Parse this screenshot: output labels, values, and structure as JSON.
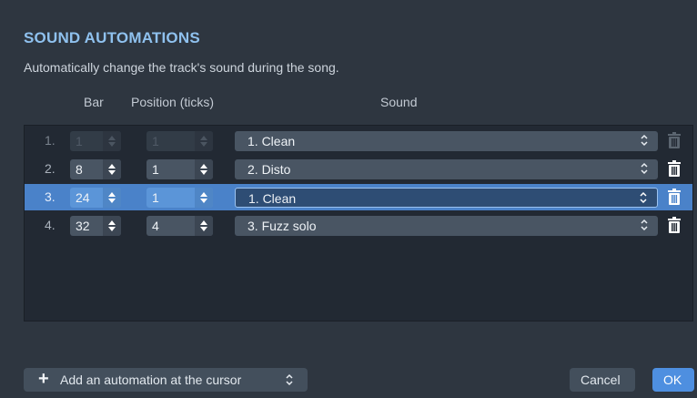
{
  "dialog": {
    "title": "SOUND AUTOMATIONS",
    "subtitle": "Automatically change the track's sound during the song."
  },
  "columns": {
    "bar": "Bar",
    "position": "Position (ticks)",
    "sound": "Sound"
  },
  "rows": [
    {
      "num": "1.",
      "bar": "1",
      "position": "1",
      "sound": "1. Clean",
      "state": "disabled"
    },
    {
      "num": "2.",
      "bar": "8",
      "position": "1",
      "sound": "2. Disto",
      "state": "normal"
    },
    {
      "num": "3.",
      "bar": "24",
      "position": "1",
      "sound": "1. Clean",
      "state": "selected"
    },
    {
      "num": "4.",
      "bar": "32",
      "position": "4",
      "sound": "3. Fuzz solo",
      "state": "normal"
    }
  ],
  "footer": {
    "add_label": "Add an automation at the cursor",
    "cancel_label": "Cancel",
    "ok_label": "OK"
  },
  "icons": {
    "add": "plus-icon",
    "select": "chevron-updown-icon",
    "stepper": "stepper-arrows-icon",
    "delete": "trash-icon"
  },
  "colors": {
    "background": "#2e3640",
    "title": "#8fc1ee",
    "selection": "#4a82c9",
    "ok_button": "#4e8fe0"
  }
}
